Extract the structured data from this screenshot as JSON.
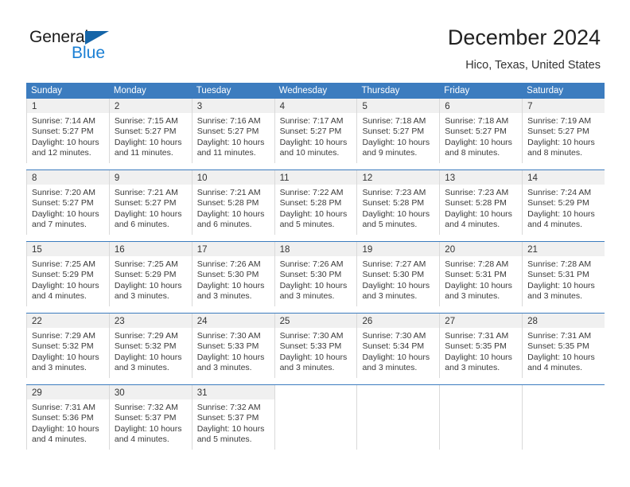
{
  "logo": {
    "text_top": "General",
    "text_bottom": "Blue"
  },
  "header": {
    "title": "December 2024",
    "subtitle": "Hico, Texas, United States"
  },
  "colors": {
    "header_blue": "#3c7cbf",
    "logo_blue": "#1a7fd4",
    "daynum_band": "#f0f0f0",
    "cell_border": "#d9d9d9"
  },
  "weekdays": [
    "Sunday",
    "Monday",
    "Tuesday",
    "Wednesday",
    "Thursday",
    "Friday",
    "Saturday"
  ],
  "weeks": [
    [
      {
        "day": "1",
        "sunrise": "Sunrise: 7:14 AM",
        "sunset": "Sunset: 5:27 PM",
        "daylight1": "Daylight: 10 hours",
        "daylight2": "and 12 minutes."
      },
      {
        "day": "2",
        "sunrise": "Sunrise: 7:15 AM",
        "sunset": "Sunset: 5:27 PM",
        "daylight1": "Daylight: 10 hours",
        "daylight2": "and 11 minutes."
      },
      {
        "day": "3",
        "sunrise": "Sunrise: 7:16 AM",
        "sunset": "Sunset: 5:27 PM",
        "daylight1": "Daylight: 10 hours",
        "daylight2": "and 11 minutes."
      },
      {
        "day": "4",
        "sunrise": "Sunrise: 7:17 AM",
        "sunset": "Sunset: 5:27 PM",
        "daylight1": "Daylight: 10 hours",
        "daylight2": "and 10 minutes."
      },
      {
        "day": "5",
        "sunrise": "Sunrise: 7:18 AM",
        "sunset": "Sunset: 5:27 PM",
        "daylight1": "Daylight: 10 hours",
        "daylight2": "and 9 minutes."
      },
      {
        "day": "6",
        "sunrise": "Sunrise: 7:18 AM",
        "sunset": "Sunset: 5:27 PM",
        "daylight1": "Daylight: 10 hours",
        "daylight2": "and 8 minutes."
      },
      {
        "day": "7",
        "sunrise": "Sunrise: 7:19 AM",
        "sunset": "Sunset: 5:27 PM",
        "daylight1": "Daylight: 10 hours",
        "daylight2": "and 8 minutes."
      }
    ],
    [
      {
        "day": "8",
        "sunrise": "Sunrise: 7:20 AM",
        "sunset": "Sunset: 5:27 PM",
        "daylight1": "Daylight: 10 hours",
        "daylight2": "and 7 minutes."
      },
      {
        "day": "9",
        "sunrise": "Sunrise: 7:21 AM",
        "sunset": "Sunset: 5:27 PM",
        "daylight1": "Daylight: 10 hours",
        "daylight2": "and 6 minutes."
      },
      {
        "day": "10",
        "sunrise": "Sunrise: 7:21 AM",
        "sunset": "Sunset: 5:28 PM",
        "daylight1": "Daylight: 10 hours",
        "daylight2": "and 6 minutes."
      },
      {
        "day": "11",
        "sunrise": "Sunrise: 7:22 AM",
        "sunset": "Sunset: 5:28 PM",
        "daylight1": "Daylight: 10 hours",
        "daylight2": "and 5 minutes."
      },
      {
        "day": "12",
        "sunrise": "Sunrise: 7:23 AM",
        "sunset": "Sunset: 5:28 PM",
        "daylight1": "Daylight: 10 hours",
        "daylight2": "and 5 minutes."
      },
      {
        "day": "13",
        "sunrise": "Sunrise: 7:23 AM",
        "sunset": "Sunset: 5:28 PM",
        "daylight1": "Daylight: 10 hours",
        "daylight2": "and 4 minutes."
      },
      {
        "day": "14",
        "sunrise": "Sunrise: 7:24 AM",
        "sunset": "Sunset: 5:29 PM",
        "daylight1": "Daylight: 10 hours",
        "daylight2": "and 4 minutes."
      }
    ],
    [
      {
        "day": "15",
        "sunrise": "Sunrise: 7:25 AM",
        "sunset": "Sunset: 5:29 PM",
        "daylight1": "Daylight: 10 hours",
        "daylight2": "and 4 minutes."
      },
      {
        "day": "16",
        "sunrise": "Sunrise: 7:25 AM",
        "sunset": "Sunset: 5:29 PM",
        "daylight1": "Daylight: 10 hours",
        "daylight2": "and 3 minutes."
      },
      {
        "day": "17",
        "sunrise": "Sunrise: 7:26 AM",
        "sunset": "Sunset: 5:30 PM",
        "daylight1": "Daylight: 10 hours",
        "daylight2": "and 3 minutes."
      },
      {
        "day": "18",
        "sunrise": "Sunrise: 7:26 AM",
        "sunset": "Sunset: 5:30 PM",
        "daylight1": "Daylight: 10 hours",
        "daylight2": "and 3 minutes."
      },
      {
        "day": "19",
        "sunrise": "Sunrise: 7:27 AM",
        "sunset": "Sunset: 5:30 PM",
        "daylight1": "Daylight: 10 hours",
        "daylight2": "and 3 minutes."
      },
      {
        "day": "20",
        "sunrise": "Sunrise: 7:28 AM",
        "sunset": "Sunset: 5:31 PM",
        "daylight1": "Daylight: 10 hours",
        "daylight2": "and 3 minutes."
      },
      {
        "day": "21",
        "sunrise": "Sunrise: 7:28 AM",
        "sunset": "Sunset: 5:31 PM",
        "daylight1": "Daylight: 10 hours",
        "daylight2": "and 3 minutes."
      }
    ],
    [
      {
        "day": "22",
        "sunrise": "Sunrise: 7:29 AM",
        "sunset": "Sunset: 5:32 PM",
        "daylight1": "Daylight: 10 hours",
        "daylight2": "and 3 minutes."
      },
      {
        "day": "23",
        "sunrise": "Sunrise: 7:29 AM",
        "sunset": "Sunset: 5:32 PM",
        "daylight1": "Daylight: 10 hours",
        "daylight2": "and 3 minutes."
      },
      {
        "day": "24",
        "sunrise": "Sunrise: 7:30 AM",
        "sunset": "Sunset: 5:33 PM",
        "daylight1": "Daylight: 10 hours",
        "daylight2": "and 3 minutes."
      },
      {
        "day": "25",
        "sunrise": "Sunrise: 7:30 AM",
        "sunset": "Sunset: 5:33 PM",
        "daylight1": "Daylight: 10 hours",
        "daylight2": "and 3 minutes."
      },
      {
        "day": "26",
        "sunrise": "Sunrise: 7:30 AM",
        "sunset": "Sunset: 5:34 PM",
        "daylight1": "Daylight: 10 hours",
        "daylight2": "and 3 minutes."
      },
      {
        "day": "27",
        "sunrise": "Sunrise: 7:31 AM",
        "sunset": "Sunset: 5:35 PM",
        "daylight1": "Daylight: 10 hours",
        "daylight2": "and 3 minutes."
      },
      {
        "day": "28",
        "sunrise": "Sunrise: 7:31 AM",
        "sunset": "Sunset: 5:35 PM",
        "daylight1": "Daylight: 10 hours",
        "daylight2": "and 4 minutes."
      }
    ],
    [
      {
        "day": "29",
        "sunrise": "Sunrise: 7:31 AM",
        "sunset": "Sunset: 5:36 PM",
        "daylight1": "Daylight: 10 hours",
        "daylight2": "and 4 minutes."
      },
      {
        "day": "30",
        "sunrise": "Sunrise: 7:32 AM",
        "sunset": "Sunset: 5:37 PM",
        "daylight1": "Daylight: 10 hours",
        "daylight2": "and 4 minutes."
      },
      {
        "day": "31",
        "sunrise": "Sunrise: 7:32 AM",
        "sunset": "Sunset: 5:37 PM",
        "daylight1": "Daylight: 10 hours",
        "daylight2": "and 5 minutes."
      },
      {
        "day": "",
        "sunrise": "",
        "sunset": "",
        "daylight1": "",
        "daylight2": ""
      },
      {
        "day": "",
        "sunrise": "",
        "sunset": "",
        "daylight1": "",
        "daylight2": ""
      },
      {
        "day": "",
        "sunrise": "",
        "sunset": "",
        "daylight1": "",
        "daylight2": ""
      },
      {
        "day": "",
        "sunrise": "",
        "sunset": "",
        "daylight1": "",
        "daylight2": ""
      }
    ]
  ]
}
